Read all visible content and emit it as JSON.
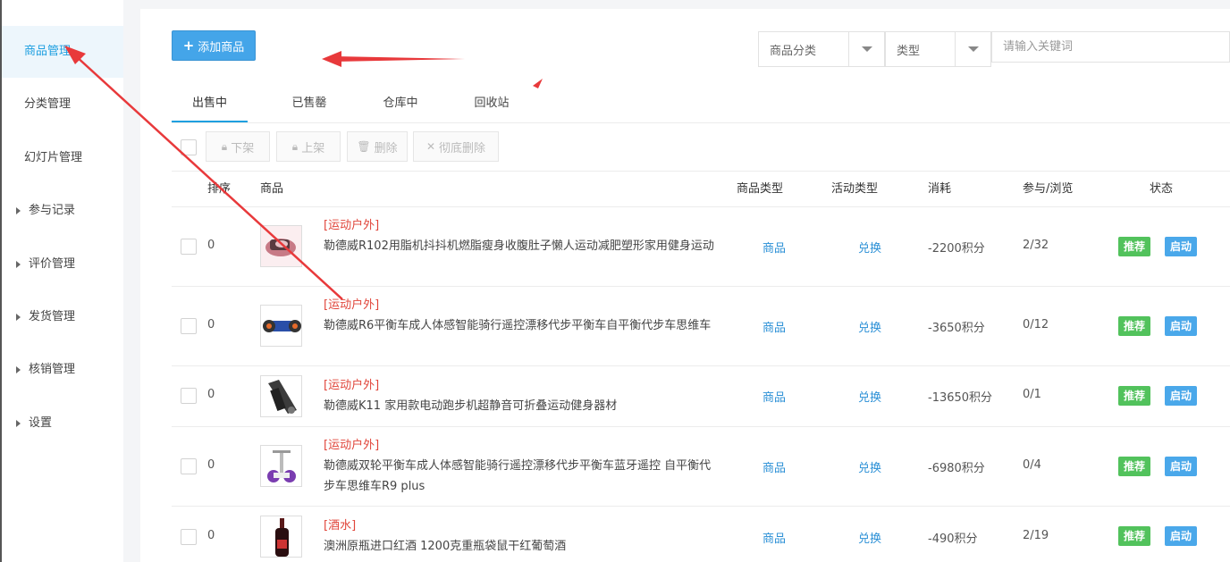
{
  "sidebar": {
    "items": [
      {
        "label": "商品管理"
      },
      {
        "label": "分类管理"
      },
      {
        "label": "幻灯片管理"
      },
      {
        "label": "参与记录"
      },
      {
        "label": "评价管理"
      },
      {
        "label": "发货管理"
      },
      {
        "label": "核销管理"
      },
      {
        "label": "设置"
      }
    ]
  },
  "toolbar": {
    "add_label": "添加商品",
    "filter_category": "商品分类",
    "filter_type": "类型",
    "search_placeholder": "请输入关键词"
  },
  "tabs": [
    {
      "label": "出售中"
    },
    {
      "label": "已售罄"
    },
    {
      "label": "仓库中"
    },
    {
      "label": "回收站"
    }
  ],
  "actions": [
    {
      "label": "下架"
    },
    {
      "label": "上架"
    },
    {
      "label": "删除"
    },
    {
      "label": "彻底删除"
    }
  ],
  "columns": [
    "排序",
    "商品",
    "商品类型",
    "活动类型",
    "消耗",
    "参与/浏览",
    "状态"
  ],
  "rows": [
    {
      "order": "0",
      "category": "[运动户外]",
      "name": "勒德威R102用脂机抖抖机燃脂瘦身收腹肚子懒人运动减肥塑形家用健身运动",
      "type": "商品",
      "activity": "兑换",
      "cost": "-2200积分",
      "stats": "2/32",
      "tag1": "推荐",
      "tag2": "启动"
    },
    {
      "order": "0",
      "category": "[运动户外]",
      "name": "勒德威R6平衡车成人体感智能骑行遥控漂移代步平衡车自平衡代步车思维车",
      "type": "商品",
      "activity": "兑换",
      "cost": "-3650积分",
      "stats": "0/12",
      "tag1": "推荐",
      "tag2": "启动"
    },
    {
      "order": "0",
      "category": "[运动户外]",
      "name": "勒德威K11 家用款电动跑步机超静音可折叠运动健身器材",
      "type": "商品",
      "activity": "兑换",
      "cost": "-13650积分",
      "stats": "0/1",
      "tag1": "推荐",
      "tag2": "启动"
    },
    {
      "order": "0",
      "category": "[运动户外]",
      "name": "勒德威双轮平衡车成人体感智能骑行遥控漂移代步平衡车蓝牙遥控 自平衡代步车思维车R9 plus",
      "type": "商品",
      "activity": "兑换",
      "cost": "-6980积分",
      "stats": "0/4",
      "tag1": "推荐",
      "tag2": "启动"
    },
    {
      "order": "0",
      "category": "[酒水]",
      "name": "澳洲原瓶进口红酒 1200克重瓶袋鼠干红葡萄酒",
      "type": "商品",
      "activity": "兑换",
      "cost": "-490积分",
      "stats": "2/19",
      "tag1": "推荐",
      "tag2": "启动"
    }
  ],
  "colors": {
    "accent": "#1e9fe0",
    "primary_button": "#44a5e9",
    "category_red": "#e0453a",
    "badge_green": "#52c25c",
    "badge_blue": "#4aa8ea",
    "annotation_arrow": "#e8393b"
  }
}
